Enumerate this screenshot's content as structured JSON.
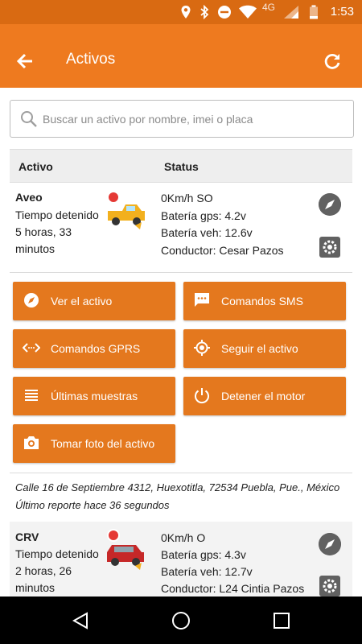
{
  "status_bar": {
    "time": "1:53",
    "network": "4G"
  },
  "app_bar": {
    "title": "Activos"
  },
  "search": {
    "placeholder": "Buscar un activo por nombre, imei o placa"
  },
  "table": {
    "headers": {
      "asset": "Activo",
      "status": "Status"
    }
  },
  "assets": [
    {
      "name": "Aveo",
      "state": "Tiempo detenido",
      "duration_line1": "5 horas, 33",
      "duration_line2": "minutos",
      "speed": "0Km/h SO",
      "gps_battery": "Batería gps: 4.2v",
      "vehicle_battery": "Batería veh: 12.6v",
      "driver": "Conductor: Cesar Pazos"
    },
    {
      "name": "CRV",
      "state": "Tiempo detenido",
      "duration_line1": "2 horas, 26",
      "duration_line2": "minutos",
      "speed": "0Km/h O",
      "gps_battery": "Batería gps: 4.3v",
      "vehicle_battery": "Batería veh: 12.7v",
      "driver": "Conductor: L24 Cintia Pazos"
    }
  ],
  "actions": {
    "view_asset": "Ver el activo",
    "sms_commands": "Comandos SMS",
    "gprs_commands": "Comandos GPRS",
    "follow_asset": "Seguir el activo",
    "last_samples": "Últimas muestras",
    "stop_engine": "Detener el motor",
    "take_photo": "Tomar foto del activo"
  },
  "location": {
    "address": "Calle 16 de Septiembre 4312, Huexotitla, 72534 Puebla, Pue., México",
    "last_report": "Último reporte hace 36 segundos"
  },
  "colors": {
    "accent": "#ee7a1f",
    "status_bar": "#d96a12",
    "button": "#e4781e"
  }
}
